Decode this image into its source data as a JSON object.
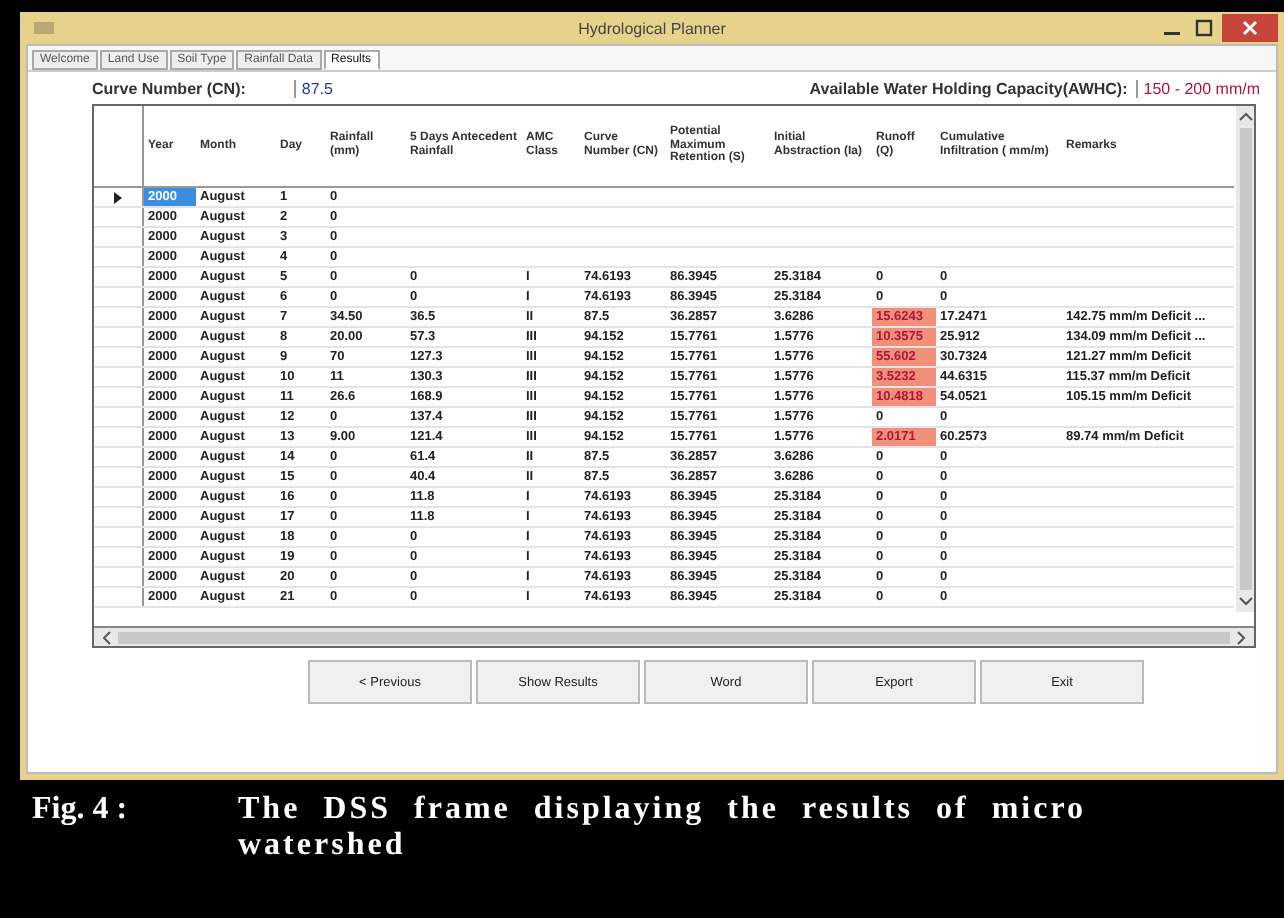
{
  "window": {
    "title": "Hydrological Planner"
  },
  "tabs": [
    {
      "label": "Welcome",
      "selected": false
    },
    {
      "label": "Land Use",
      "selected": false
    },
    {
      "label": "Soil Type",
      "selected": false
    },
    {
      "label": "Rainfall Data",
      "selected": false
    },
    {
      "label": "Results",
      "selected": true
    }
  ],
  "curve_number": {
    "label": "Curve Number (CN):",
    "value": "87.5"
  },
  "awhc": {
    "label": "Available Water Holding Capacity(AWHC):",
    "value": "150 - 200 mm/m"
  },
  "table": {
    "columns": [
      "Year",
      "Month",
      "Day",
      "Rainfall (mm)",
      "5 Days Antecedent Rainfall",
      "AMC Class",
      "Curve Number (CN)",
      "Potential Maximum Retention (S)",
      "Initial Abstraction (Ia)",
      "Runoff (Q)",
      "Cumulative Infiltration ( mm/m)",
      "Remarks"
    ],
    "rows": [
      {
        "current": true,
        "highlighted": false,
        "cells": [
          "2000",
          "August",
          "1",
          "0",
          "",
          "",
          "",
          "",
          "",
          "",
          "",
          ""
        ]
      },
      {
        "current": false,
        "highlighted": false,
        "cells": [
          "2000",
          "August",
          "2",
          "0",
          "",
          "",
          "",
          "",
          "",
          "",
          "",
          ""
        ]
      },
      {
        "current": false,
        "highlighted": false,
        "cells": [
          "2000",
          "August",
          "3",
          "0",
          "",
          "",
          "",
          "",
          "",
          "",
          "",
          ""
        ]
      },
      {
        "current": false,
        "highlighted": false,
        "cells": [
          "2000",
          "August",
          "4",
          "0",
          "",
          "",
          "",
          "",
          "",
          "",
          "",
          ""
        ]
      },
      {
        "current": false,
        "highlighted": false,
        "cells": [
          "2000",
          "August",
          "5",
          "0",
          "0",
          "I",
          "74.6193",
          "86.3945",
          "25.3184",
          "0",
          "0",
          ""
        ]
      },
      {
        "current": false,
        "highlighted": false,
        "cells": [
          "2000",
          "August",
          "6",
          "0",
          "0",
          "I",
          "74.6193",
          "86.3945",
          "25.3184",
          "0",
          "0",
          ""
        ]
      },
      {
        "current": false,
        "highlighted": true,
        "cells": [
          "2000",
          "August",
          "7",
          "34.50",
          "36.5",
          "II",
          "87.5",
          "36.2857",
          "3.6286",
          "15.6243",
          "17.2471",
          "142.75 mm/m Deficit ..."
        ]
      },
      {
        "current": false,
        "highlighted": true,
        "cells": [
          "2000",
          "August",
          "8",
          "20.00",
          "57.3",
          "III",
          "94.152",
          "15.7761",
          "1.5776",
          "10.3575",
          "25.912",
          "134.09 mm/m Deficit ..."
        ]
      },
      {
        "current": false,
        "highlighted": true,
        "cells": [
          "2000",
          "August",
          "9",
          "70",
          "127.3",
          "III",
          "94.152",
          "15.7761",
          "1.5776",
          "55.602",
          "30.7324",
          "121.27 mm/m Deficit"
        ]
      },
      {
        "current": false,
        "highlighted": true,
        "cells": [
          "2000",
          "August",
          "10",
          "11",
          "130.3",
          "III",
          "94.152",
          "15.7761",
          "1.5776",
          "3.5232",
          "44.6315",
          "115.37 mm/m Deficit"
        ]
      },
      {
        "current": false,
        "highlighted": true,
        "cells": [
          "2000",
          "August",
          "11",
          "26.6",
          "168.9",
          "III",
          "94.152",
          "15.7761",
          "1.5776",
          "10.4818",
          "54.0521",
          "105.15 mm/m Deficit"
        ]
      },
      {
        "current": false,
        "highlighted": false,
        "cells": [
          "2000",
          "August",
          "12",
          "0",
          "137.4",
          "III",
          "94.152",
          "15.7761",
          "1.5776",
          "0",
          "0",
          ""
        ]
      },
      {
        "current": false,
        "highlighted": true,
        "cells": [
          "2000",
          "August",
          "13",
          "9.00",
          "121.4",
          "III",
          "94.152",
          "15.7761",
          "1.5776",
          "2.0171",
          "60.2573",
          "89.74 mm/m Deficit"
        ]
      },
      {
        "current": false,
        "highlighted": false,
        "cells": [
          "2000",
          "August",
          "14",
          "0",
          "61.4",
          "II",
          "87.5",
          "36.2857",
          "3.6286",
          "0",
          "0",
          ""
        ]
      },
      {
        "current": false,
        "highlighted": false,
        "cells": [
          "2000",
          "August",
          "15",
          "0",
          "40.4",
          "II",
          "87.5",
          "36.2857",
          "3.6286",
          "0",
          "0",
          ""
        ]
      },
      {
        "current": false,
        "highlighted": false,
        "cells": [
          "2000",
          "August",
          "16",
          "0",
          "11.8",
          "I",
          "74.6193",
          "86.3945",
          "25.3184",
          "0",
          "0",
          ""
        ]
      },
      {
        "current": false,
        "highlighted": false,
        "cells": [
          "2000",
          "August",
          "17",
          "0",
          "11.8",
          "I",
          "74.6193",
          "86.3945",
          "25.3184",
          "0",
          "0",
          ""
        ]
      },
      {
        "current": false,
        "highlighted": false,
        "cells": [
          "2000",
          "August",
          "18",
          "0",
          "0",
          "I",
          "74.6193",
          "86.3945",
          "25.3184",
          "0",
          "0",
          ""
        ]
      },
      {
        "current": false,
        "highlighted": false,
        "cells": [
          "2000",
          "August",
          "19",
          "0",
          "0",
          "I",
          "74.6193",
          "86.3945",
          "25.3184",
          "0",
          "0",
          ""
        ]
      },
      {
        "current": false,
        "highlighted": false,
        "cells": [
          "2000",
          "August",
          "20",
          "0",
          "0",
          "I",
          "74.6193",
          "86.3945",
          "25.3184",
          "0",
          "0",
          ""
        ]
      },
      {
        "current": false,
        "highlighted": false,
        "cells": [
          "2000",
          "August",
          "21",
          "0",
          "0",
          "I",
          "74.6193",
          "86.3945",
          "25.3184",
          "0",
          "0",
          ""
        ]
      }
    ]
  },
  "buttons": [
    "< Previous",
    "Show Results",
    "Word",
    "Export",
    "Exit"
  ],
  "caption": {
    "label": "Fig. 4 :",
    "text": "The DSS frame displaying the results of micro watershed"
  }
}
